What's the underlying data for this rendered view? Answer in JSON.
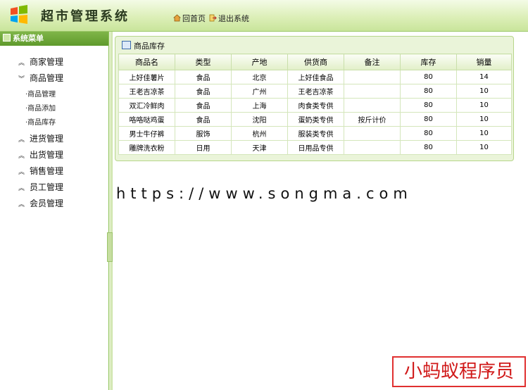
{
  "header": {
    "title": "超市管理系统",
    "home_label": "回首页",
    "logout_label": "退出系统"
  },
  "sidebar": {
    "heading": "系统菜单",
    "menus": [
      {
        "label": "商家管理",
        "state": "collapsed"
      },
      {
        "label": "商品管理",
        "state": "expanded"
      },
      {
        "label": "进货管理",
        "state": "collapsed"
      },
      {
        "label": "出货管理",
        "state": "collapsed"
      },
      {
        "label": "销售管理",
        "state": "collapsed"
      },
      {
        "label": "员工管理",
        "state": "collapsed"
      },
      {
        "label": "会员管理",
        "state": "collapsed"
      }
    ],
    "submenu": [
      "·商品管理",
      "·商品添加",
      "·商品库存"
    ]
  },
  "panel": {
    "title": "商品库存",
    "columns": [
      "商品名",
      "类型",
      "产地",
      "供货商",
      "备注",
      "库存",
      "销量"
    ],
    "rows": [
      [
        "上好佳薯片",
        "食品",
        "北京",
        "上好佳食品",
        "",
        "80",
        "14"
      ],
      [
        "王老吉凉茶",
        "食品",
        "广州",
        "王老吉凉茶",
        "",
        "80",
        "10"
      ],
      [
        "双汇冷鲜肉",
        "食品",
        "上海",
        "肉食类专供",
        "",
        "80",
        "10"
      ],
      [
        "咯咯哒鸡蛋",
        "食品",
        "沈阳",
        "蛋奶类专供",
        "按斤计价",
        "80",
        "10"
      ],
      [
        "男士牛仔裤",
        "服饰",
        "杭州",
        "服装类专供",
        "",
        "80",
        "10"
      ],
      [
        "雕牌洗衣粉",
        "日用",
        "天津",
        "日用品专供",
        "",
        "80",
        "10"
      ]
    ]
  },
  "watermark": "https://www.songma.com",
  "brand": "小蚂蚁程序员",
  "colors": {
    "accent_green": "#7fb548",
    "brand_red": "#d01818"
  }
}
